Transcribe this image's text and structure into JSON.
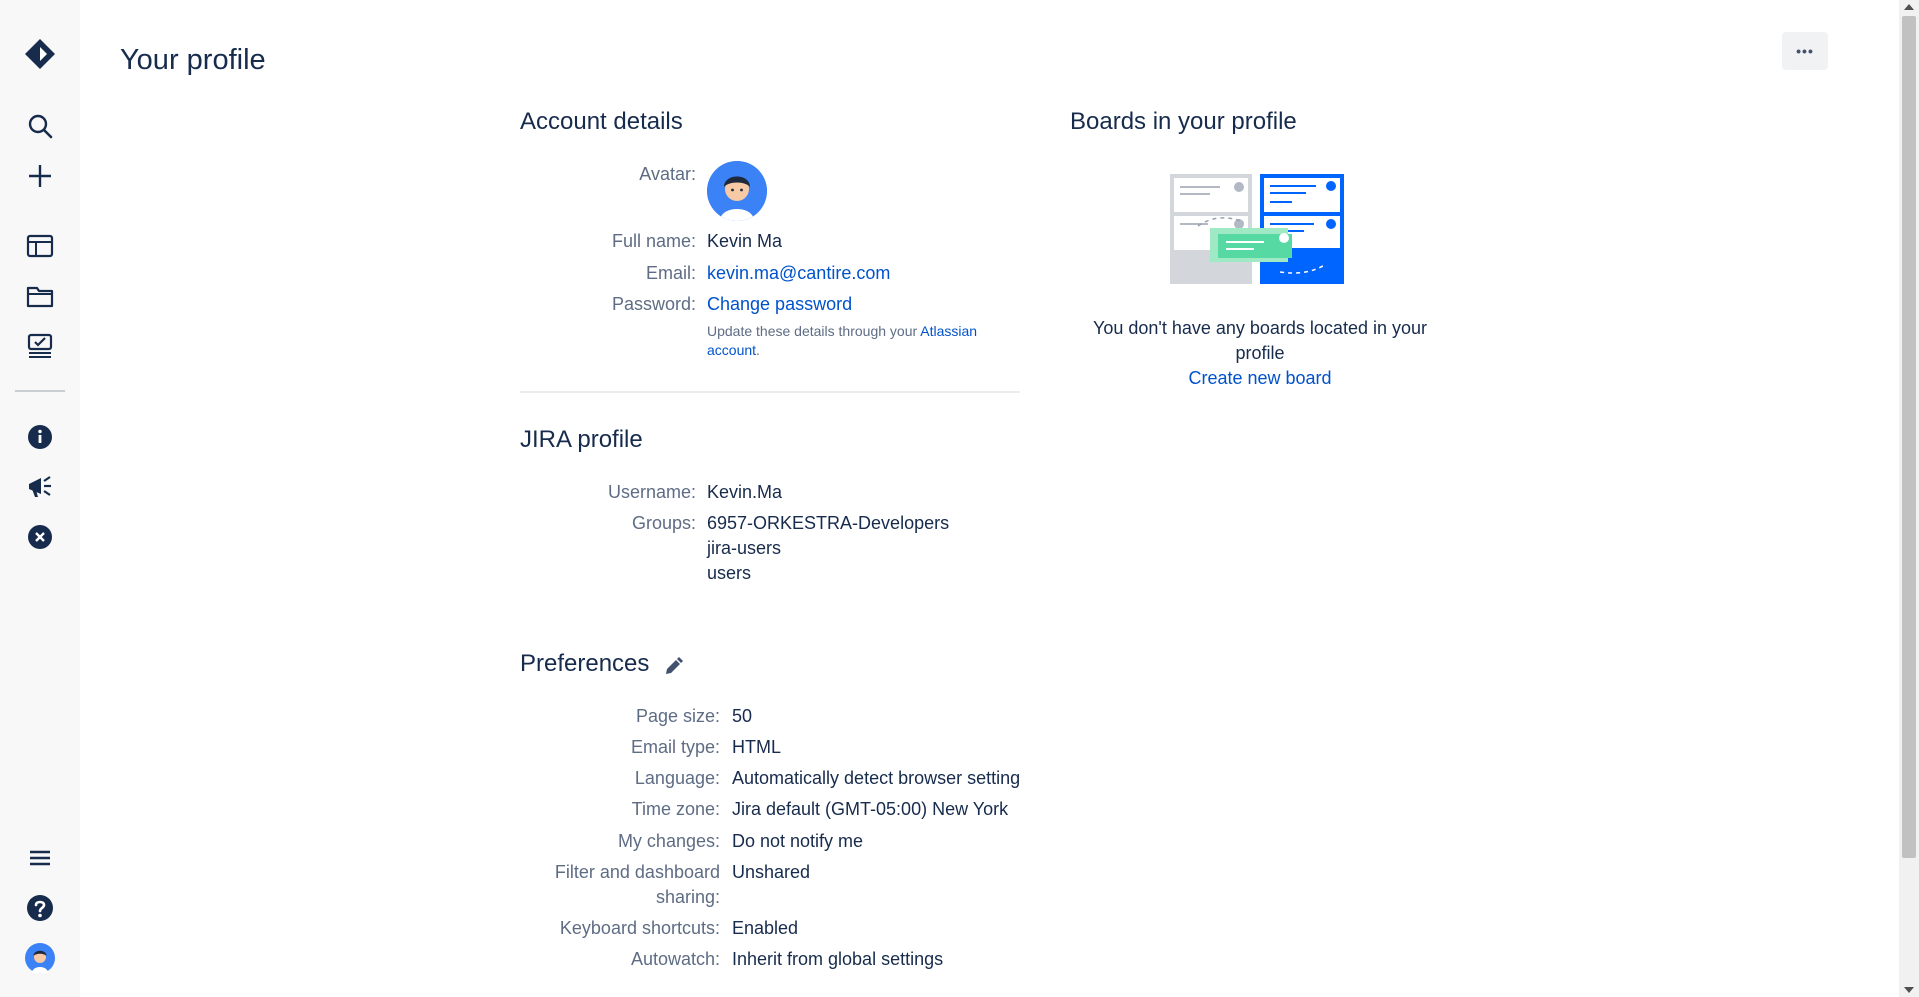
{
  "page": {
    "title": "Your profile"
  },
  "sidebar": {
    "icons": [
      "jira-logo-icon",
      "search-icon",
      "plus-icon",
      "board-icon",
      "folder-icon",
      "checklist-icon",
      "info-icon",
      "megaphone-icon",
      "close-circle-icon",
      "menu-icon",
      "help-icon",
      "avatar-icon"
    ]
  },
  "toolbar": {
    "more_label": "•••"
  },
  "account": {
    "title": "Account details",
    "avatar_label": "Avatar:",
    "fullname_label": "Full name:",
    "fullname": "Kevin Ma",
    "email_label": "Email:",
    "email": "kevin.ma@cantire.com",
    "password_label": "Password:",
    "password_link": "Change password",
    "hint_prefix": "Update these details through your ",
    "hint_link_1": "Atlassian",
    "hint_link_2": "account",
    "hint_suffix": "."
  },
  "jira": {
    "title": "JIRA profile",
    "username_label": "Username:",
    "username": "Kevin.Ma",
    "groups_label": "Groups:",
    "groups": [
      "6957-ORKESTRA-Developers",
      "jira-users",
      "users"
    ]
  },
  "preferences": {
    "title": "Preferences",
    "rows": [
      {
        "label": "Page size:",
        "value": "50"
      },
      {
        "label": "Email type:",
        "value": "HTML"
      },
      {
        "label": "Language:",
        "value": "Automatically detect browser setting"
      },
      {
        "label": "Time zone:",
        "value": "Jira default (GMT-05:00) New York"
      },
      {
        "label": "My changes:",
        "value": "Do not notify me"
      },
      {
        "label_line1": "Filter and dashboard",
        "label_line2": "sharing:",
        "value": "Unshared"
      },
      {
        "label": "Keyboard shortcuts:",
        "value": "Enabled"
      },
      {
        "label": "Autowatch:",
        "value": "Inherit from global settings"
      }
    ]
  },
  "boards": {
    "title": "Boards in your profile",
    "empty_line1": "You don't have any boards located in your",
    "empty_line2": "profile",
    "create_link": "Create new board"
  },
  "colors": {
    "accent": "#0052cc",
    "text": "#172b4d",
    "muted": "#5e6c84",
    "board_blue": "#0065ff"
  }
}
